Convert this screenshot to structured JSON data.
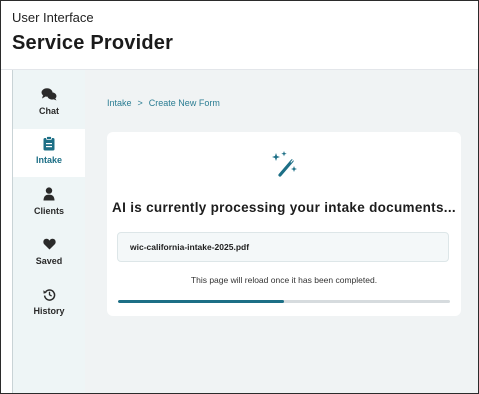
{
  "header": {
    "subtitle": "User Interface",
    "title": "Service Provider"
  },
  "sidebar": {
    "items": [
      {
        "label": "Chat",
        "icon": "chat-icon",
        "active": false
      },
      {
        "label": "Intake",
        "icon": "clipboard-icon",
        "active": true
      },
      {
        "label": "Clients",
        "icon": "person-icon",
        "active": false
      },
      {
        "label": "Saved",
        "icon": "heart-icon",
        "active": false
      },
      {
        "label": "History",
        "icon": "history-icon",
        "active": false
      }
    ]
  },
  "breadcrumb": {
    "root": "Intake",
    "separator": ">",
    "current": "Create New Form"
  },
  "processing": {
    "icon": "magic-wand-icon",
    "title": "AI is currently processing your intake documents...",
    "file_name": "wic-california-intake-2025.pdf",
    "note": "This page will reload once it has been completed.",
    "progress_fraction": 0.5
  },
  "colors": {
    "accent": "#1c6f86",
    "sidebar_bg": "#eef5f6",
    "main_bg": "#f0f3f4"
  }
}
